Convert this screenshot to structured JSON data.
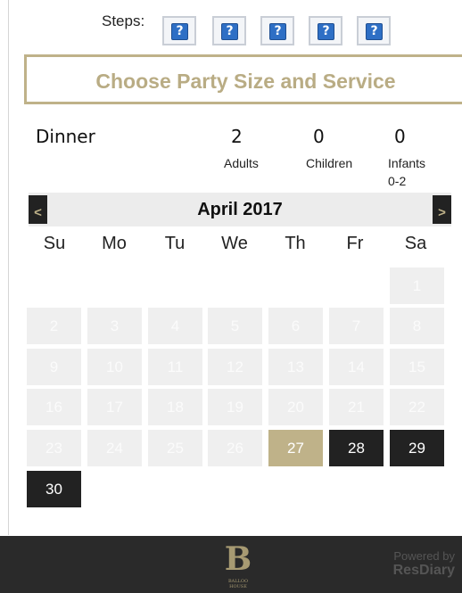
{
  "steps": {
    "label": "Steps:",
    "icons": [
      "?",
      "?",
      "?",
      "?",
      "?"
    ]
  },
  "title": "Choose Party Size and Service",
  "party": {
    "service": "Dinner",
    "adults": {
      "count": "2",
      "label": "Adults"
    },
    "children": {
      "count": "0",
      "label": "Children"
    },
    "infants": {
      "count": "0",
      "label_1": "Infants",
      "label_2": "0-2"
    }
  },
  "calendar": {
    "prev": "<",
    "next": ">",
    "month": "April 2017",
    "weekdays": [
      "Su",
      "Mo",
      "Tu",
      "We",
      "Th",
      "Fr",
      "Sa"
    ],
    "days": [
      "1",
      "2",
      "3",
      "4",
      "5",
      "6",
      "7",
      "8",
      "9",
      "10",
      "11",
      "12",
      "13",
      "14",
      "15",
      "16",
      "17",
      "18",
      "19",
      "20",
      "21",
      "22",
      "23",
      "24",
      "25",
      "26",
      "27",
      "28",
      "29",
      "30"
    ],
    "selected_day": "27",
    "available_days": [
      "28",
      "29",
      "30"
    ],
    "colors": {
      "disabled": "#efefef",
      "selected": "#bfb289",
      "available": "#222222"
    }
  },
  "footer": {
    "logo": {
      "letter": "B",
      "line_1": "BALLOO",
      "line_2": "HOUSE"
    },
    "powered_1": "Powered by",
    "powered_2": "ResDiary"
  }
}
